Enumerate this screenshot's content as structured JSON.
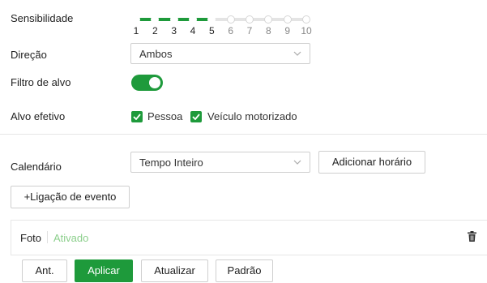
{
  "sensitivity": {
    "label": "Sensibilidade",
    "value": 5,
    "min": 1,
    "max": 10,
    "ticks": [
      "1",
      "2",
      "3",
      "4",
      "5",
      "6",
      "7",
      "8",
      "9",
      "10"
    ],
    "accent": "#1e9a3b"
  },
  "direction": {
    "label": "Direção",
    "value": "Ambos"
  },
  "target_filter": {
    "label": "Filtro de alvo",
    "enabled": true
  },
  "effective_target": {
    "label": "Alvo efetivo",
    "options": [
      {
        "label": "Pessoa",
        "checked": true
      },
      {
        "label": "Veículo motorizado",
        "checked": true
      }
    ]
  },
  "calendar": {
    "label": "Calendário",
    "value": "Tempo Inteiro",
    "add_button": "Adicionar horário"
  },
  "event_link": {
    "button": "+Ligação de evento"
  },
  "photo": {
    "name": "Foto",
    "status": "Ativado",
    "status_color": "#8ccf8c",
    "delete_icon": "trash-icon"
  },
  "footer": {
    "prev": "Ant.",
    "apply": "Aplicar",
    "refresh": "Atualizar",
    "default": "Padrão"
  }
}
